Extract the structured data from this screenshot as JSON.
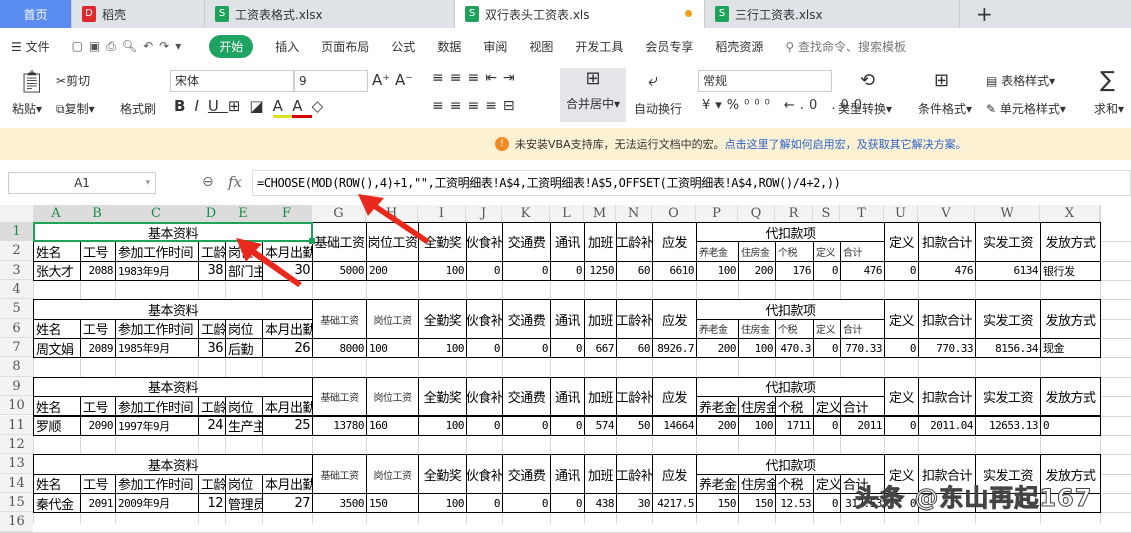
{
  "tabs": [
    {
      "label": "首页"
    },
    {
      "label": "稻壳"
    },
    {
      "label": "工资表格式.xlsx"
    },
    {
      "label": "双行表头工资表.xls"
    },
    {
      "label": "三行工资表.xlsx"
    }
  ],
  "menu": {
    "file": "文件",
    "items": [
      "开始",
      "插入",
      "页面布局",
      "公式",
      "数据",
      "审阅",
      "视图",
      "开发工具",
      "会员专享",
      "稻壳资源"
    ],
    "search": "查找命令、搜索模板"
  },
  "ribbon": {
    "paste": "粘贴",
    "cut": "剪切",
    "copy": "复制",
    "format_painter": "格式刷",
    "font": "宋体",
    "size": "9",
    "merge": "合并居中",
    "wrap": "自动换行",
    "numfmt": "常规",
    "convert": "类型转换",
    "cond": "条件格式",
    "table_style": "表格样式",
    "cell_style": "单元格样式",
    "sum": "求和"
  },
  "notice": {
    "text": "未安装VBA支持库，无法运行文档中的宏。",
    "link": "点击这里了解如何启用宏，及获取其它解决方案。"
  },
  "formula": {
    "cell_ref": "A1",
    "fx": "fx",
    "value": "=CHOOSE(MOD(ROW(),4)+1,\"\",工资明细表!A$4,工资明细表!A$5,OFFSET(工资明细表!A$4,ROW()/4+2,))"
  },
  "columns": [
    "A",
    "B",
    "C",
    "D",
    "E",
    "F",
    "G",
    "H",
    "I",
    "J",
    "K",
    "L",
    "M",
    "N",
    "O",
    "P",
    "Q",
    "R",
    "S",
    "T",
    "U",
    "V",
    "W",
    "X"
  ],
  "sheet": {
    "group1": "基本资料",
    "group2": "代扣款项",
    "basic_headers": [
      "姓名",
      "工号",
      "参加工作时间",
      "工龄",
      "岗位",
      "本月出勤"
    ],
    "pay_headers": [
      "基础工资",
      "岗位工资",
      "全勤奖",
      "伙食补",
      "交通费",
      "通讯",
      "加班",
      "工龄补",
      "应发"
    ],
    "deduct_headers": [
      "养老金",
      "住房金",
      "个税",
      "定义",
      "合计"
    ],
    "tail_headers": [
      "定义",
      "扣款合计",
      "实发工资",
      "发放方式"
    ],
    "records": [
      [
        "张大才",
        "2088",
        "1983年9月",
        "38",
        "部门主",
        "30",
        "5000",
        "200",
        "100",
        "0",
        "0",
        "0",
        "1250",
        "60",
        "6610",
        "100",
        "200",
        "176",
        "0",
        "476",
        "0",
        "476",
        "6134",
        "银行发"
      ],
      [
        "周文娟",
        "2089",
        "1985年9月",
        "36",
        "后勤",
        "26",
        "8000",
        "100",
        "100",
        "0",
        "0",
        "0",
        "667",
        "60",
        "8926.7",
        "200",
        "100",
        "470.3",
        "0",
        "770.33",
        "0",
        "770.33",
        "8156.34",
        "现金"
      ],
      [
        "罗顺",
        "2090",
        "1997年9月",
        "24",
        "生产主",
        "25",
        "13780",
        "160",
        "100",
        "0",
        "0",
        "0",
        "574",
        "50",
        "14664",
        "200",
        "100",
        "1711",
        "0",
        "2011",
        "0",
        "2011.04",
        "12653.13",
        "0"
      ],
      [
        "秦代金",
        "2091",
        "2009年9月",
        "12",
        "管理员",
        "27",
        "3500",
        "150",
        "100",
        "0",
        "0",
        "0",
        "438",
        "30",
        "4217.5",
        "150",
        "150",
        "12.53",
        "0",
        "312.53",
        "0",
        "",
        "",
        ""
      ]
    ]
  },
  "watermark": "头条 @东山再起167",
  "colors": {
    "accent": "#1ea362",
    "home_tab": "#5b8cf0",
    "selection": "#1fa35a",
    "arrow": "#e8291c"
  }
}
